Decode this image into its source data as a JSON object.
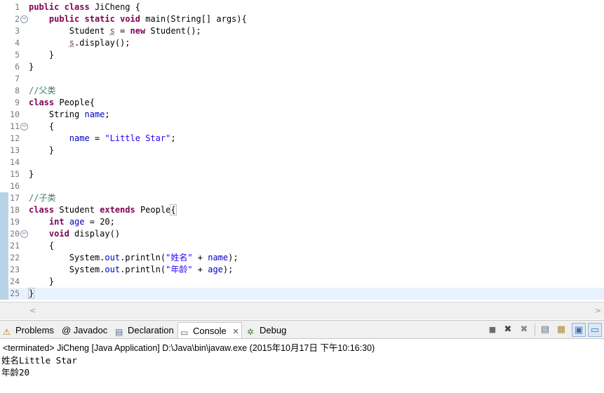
{
  "editor": {
    "lines": [
      {
        "n": "1",
        "fold": "",
        "code": [
          {
            "t": "public",
            "c": "kw"
          },
          {
            "t": " "
          },
          {
            "t": "class",
            "c": "kw"
          },
          {
            "t": " JiCheng {"
          }
        ]
      },
      {
        "n": "2",
        "fold": "⊖",
        "code": [
          {
            "t": "    "
          },
          {
            "t": "public",
            "c": "kw"
          },
          {
            "t": " "
          },
          {
            "t": "static",
            "c": "kw"
          },
          {
            "t": " "
          },
          {
            "t": "void",
            "c": "kw"
          },
          {
            "t": " main(String[] args){"
          }
        ]
      },
      {
        "n": "3",
        "fold": "",
        "code": [
          {
            "t": "        Student "
          },
          {
            "t": "s",
            "c": "var"
          },
          {
            "t": " = "
          },
          {
            "t": "new",
            "c": "kw"
          },
          {
            "t": " Student();"
          }
        ]
      },
      {
        "n": "4",
        "fold": "",
        "code": [
          {
            "t": "        "
          },
          {
            "t": "s",
            "c": "var"
          },
          {
            "t": ".display();"
          }
        ]
      },
      {
        "n": "5",
        "fold": "",
        "code": [
          {
            "t": "    }"
          }
        ]
      },
      {
        "n": "6",
        "fold": "",
        "code": [
          {
            "t": "}"
          }
        ]
      },
      {
        "n": "7",
        "fold": "",
        "code": []
      },
      {
        "n": "8",
        "fold": "",
        "code": [
          {
            "t": "//父类",
            "c": "cmt"
          }
        ]
      },
      {
        "n": "9",
        "fold": "",
        "code": [
          {
            "t": "class",
            "c": "kw"
          },
          {
            "t": " People{"
          }
        ]
      },
      {
        "n": "10",
        "fold": "",
        "code": [
          {
            "t": "    String "
          },
          {
            "t": "name",
            "c": "fld"
          },
          {
            "t": ";"
          }
        ]
      },
      {
        "n": "11",
        "fold": "⊖",
        "code": [
          {
            "t": "    {"
          }
        ]
      },
      {
        "n": "12",
        "fold": "",
        "code": [
          {
            "t": "        "
          },
          {
            "t": "name",
            "c": "fld"
          },
          {
            "t": " = "
          },
          {
            "t": "\"Little Star\"",
            "c": "str"
          },
          {
            "t": ";"
          }
        ]
      },
      {
        "n": "13",
        "fold": "",
        "code": [
          {
            "t": "    }"
          }
        ]
      },
      {
        "n": "14",
        "fold": "",
        "code": []
      },
      {
        "n": "15",
        "fold": "",
        "code": [
          {
            "t": "}"
          }
        ]
      },
      {
        "n": "16",
        "fold": "",
        "code": []
      },
      {
        "n": "17",
        "fold": "",
        "code": [
          {
            "t": "//子类",
            "c": "cmt"
          }
        ]
      },
      {
        "n": "18",
        "fold": "",
        "code": [
          {
            "t": "class",
            "c": "kw"
          },
          {
            "t": " Student "
          },
          {
            "t": "extends",
            "c": "kw"
          },
          {
            "t": " People"
          },
          {
            "t": "{",
            "c": "bracket"
          }
        ]
      },
      {
        "n": "19",
        "fold": "",
        "code": [
          {
            "t": "    "
          },
          {
            "t": "int",
            "c": "kw"
          },
          {
            "t": " "
          },
          {
            "t": "age",
            "c": "fld"
          },
          {
            "t": " = 20;"
          }
        ]
      },
      {
        "n": "20",
        "fold": "⊖",
        "code": [
          {
            "t": "    "
          },
          {
            "t": "void",
            "c": "kw"
          },
          {
            "t": " display()"
          }
        ]
      },
      {
        "n": "21",
        "fold": "",
        "code": [
          {
            "t": "    {"
          }
        ]
      },
      {
        "n": "22",
        "fold": "",
        "code": [
          {
            "t": "        System."
          },
          {
            "t": "out",
            "c": "fld"
          },
          {
            "t": ".println("
          },
          {
            "t": "\"姓名\"",
            "c": "str"
          },
          {
            "t": " + "
          },
          {
            "t": "name",
            "c": "fld"
          },
          {
            "t": ");"
          }
        ]
      },
      {
        "n": "23",
        "fold": "",
        "code": [
          {
            "t": "        System."
          },
          {
            "t": "out",
            "c": "fld"
          },
          {
            "t": ".println("
          },
          {
            "t": "\"年龄\"",
            "c": "str"
          },
          {
            "t": " + "
          },
          {
            "t": "age",
            "c": "fld"
          },
          {
            "t": ");"
          }
        ]
      },
      {
        "n": "24",
        "fold": "",
        "code": [
          {
            "t": "    }"
          }
        ]
      },
      {
        "n": "25",
        "fold": "",
        "code": [
          {
            "t": "}",
            "c": "bracket"
          }
        ]
      }
    ],
    "current_line": "25",
    "changed_lines": [
      "17",
      "18",
      "19",
      "20",
      "21",
      "22",
      "23",
      "24",
      "25"
    ]
  },
  "scroll": {
    "left_arrow": "<",
    "right_arrow": ">"
  },
  "tabs": [
    {
      "label": "Problems",
      "icon": "problems-icon",
      "glyph": "⚠"
    },
    {
      "label": "@ Javadoc",
      "icon": "javadoc-icon",
      "glyph": ""
    },
    {
      "label": "Declaration",
      "icon": "declaration-icon",
      "glyph": "▤"
    },
    {
      "label": "Console",
      "icon": "console-icon",
      "glyph": "▭",
      "close": "✕"
    },
    {
      "label": "Debug",
      "icon": "debug-icon",
      "glyph": "✲"
    }
  ],
  "console": {
    "terminated_label": "<terminated> JiCheng [Java Application] D:\\Java\\bin\\javaw.exe (2015年10月17日 下午10:16:30)",
    "output": [
      "姓名Little Star",
      "年龄20"
    ]
  },
  "toolbar": {
    "icons": [
      {
        "name": "terminate-icon",
        "glyph": "■"
      },
      {
        "name": "remove-launch-icon",
        "glyph": "✖"
      },
      {
        "name": "remove-all-terminated-icon",
        "glyph": "✖"
      },
      {
        "name": "scroll-lock-icon",
        "glyph": "▤"
      },
      {
        "name": "word-wrap-icon",
        "glyph": "▦"
      },
      {
        "name": "pin-console-icon",
        "glyph": "▣"
      },
      {
        "name": "display-selected-console-icon",
        "glyph": "▭"
      },
      {
        "name": "open-console-icon",
        "glyph": "▭"
      }
    ]
  },
  "colors": {
    "keyword": "#7f0055",
    "field": "#0000c0",
    "string": "#2a00ff",
    "comment": "#3f7f5f",
    "current_line": "#e8f2fe",
    "changed_bar": "#b9d3e6"
  }
}
